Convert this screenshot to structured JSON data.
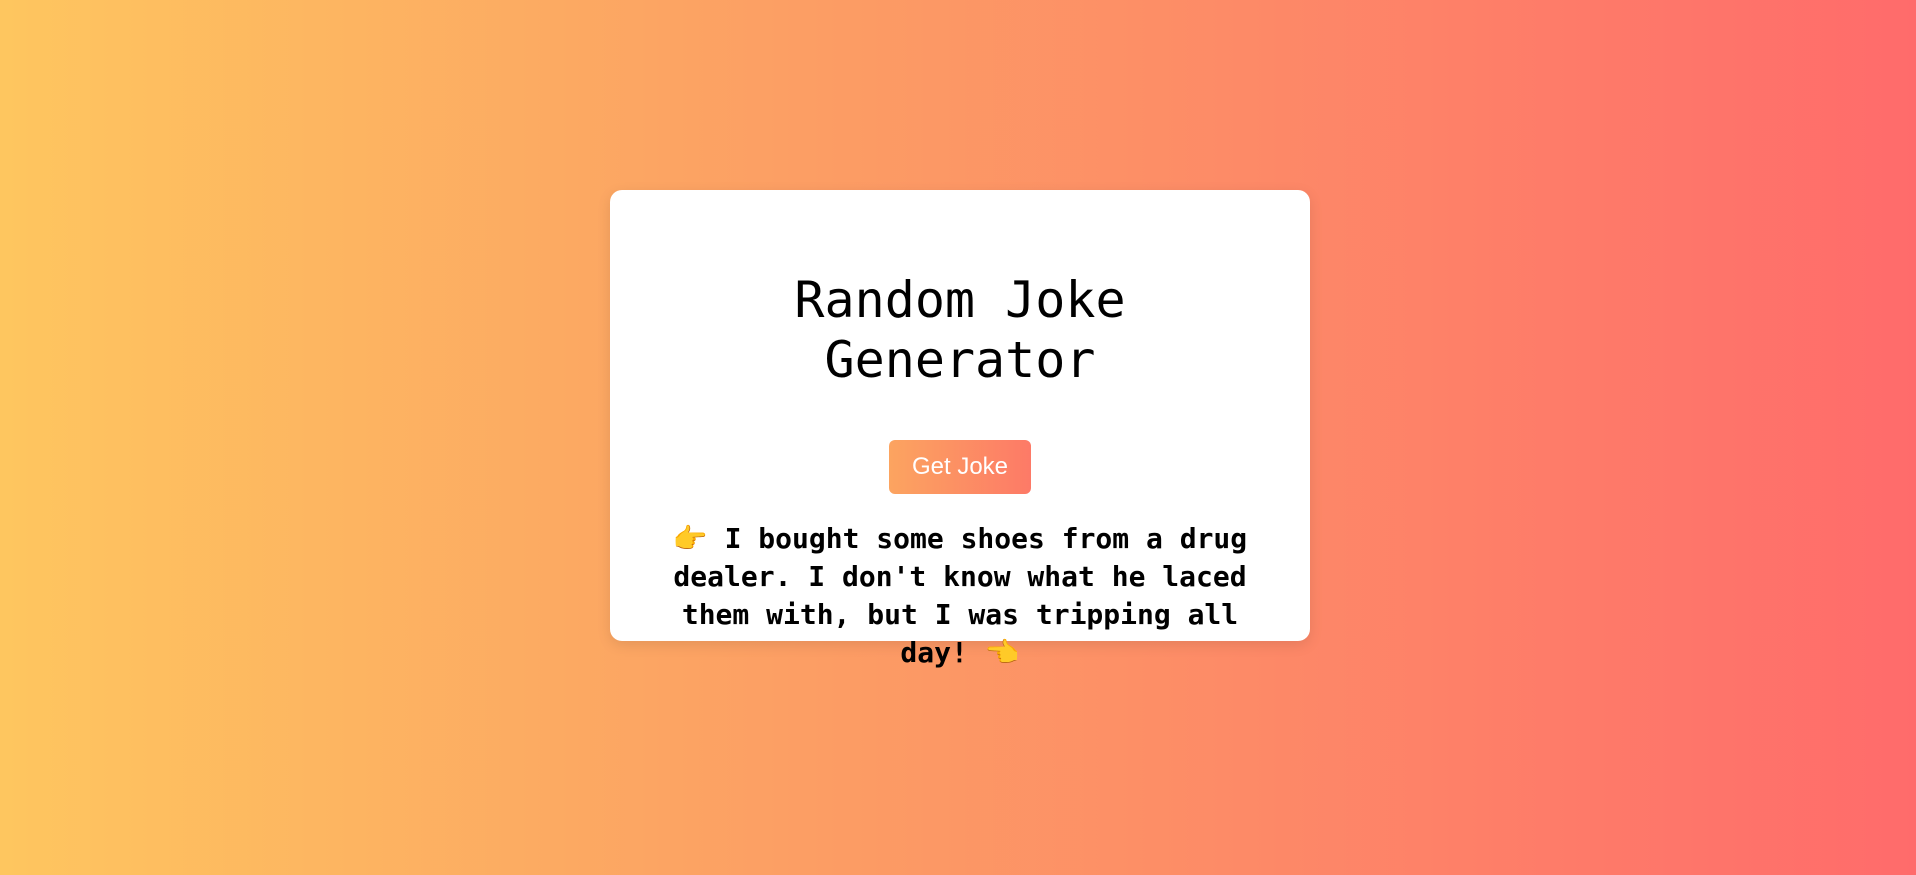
{
  "app": {
    "title": "Random Joke Generator"
  },
  "actions": {
    "get_joke_label": "Get Joke"
  },
  "joke": {
    "prefix_emoji": "👉",
    "text": "I bought some shoes from a drug dealer. I don't know what he laced them with, but I was tripping all day!",
    "suffix_emoji": "👈"
  },
  "colors": {
    "background_start": "#fec65f",
    "background_end": "#ff6b6b",
    "card": "#ffffff",
    "button_start": "#fca460",
    "button_end": "#fd7a67"
  }
}
